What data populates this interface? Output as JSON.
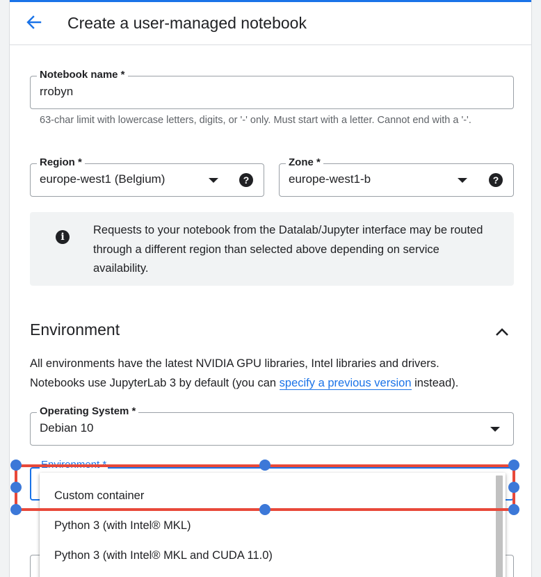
{
  "header": {
    "title": "Create a user-managed notebook",
    "back_icon": "arrow-back-icon"
  },
  "notebook_name": {
    "label": "Notebook name *",
    "value": "rrobyn",
    "hint": "63-char limit with lowercase letters, digits, or '-' only. Must start with a letter. Cannot end with a '-'."
  },
  "region": {
    "label": "Region *",
    "value": "europe-west1 (Belgium)",
    "help": "?"
  },
  "zone": {
    "label": "Zone *",
    "value": "europe-west1-b",
    "help": "?"
  },
  "info": {
    "icon": "i",
    "text": "Requests to your notebook from the Datalab/Jupyter interface may be routed through a different region than selected above depending on service availability."
  },
  "environment_section": {
    "title": "Environment",
    "desc_line1": "All environments have the latest NVIDIA GPU libraries, Intel libraries and drivers.",
    "desc_prefix": "Notebooks use JupyterLab 3 by default (you can ",
    "desc_link": "specify a previous version",
    "desc_suffix": " instead)."
  },
  "operating_system": {
    "label": "Operating System *",
    "value": "Debian 10"
  },
  "environment": {
    "label": "Environment *",
    "options": [
      "Custom container",
      "Python 3 (with Intel® MKL)",
      "Python 3 (with Intel® MKL and CUDA 11.0)"
    ]
  },
  "colors": {
    "accent": "#1a73e8",
    "selection": "#e8493a",
    "handle": "#3c78d8"
  }
}
